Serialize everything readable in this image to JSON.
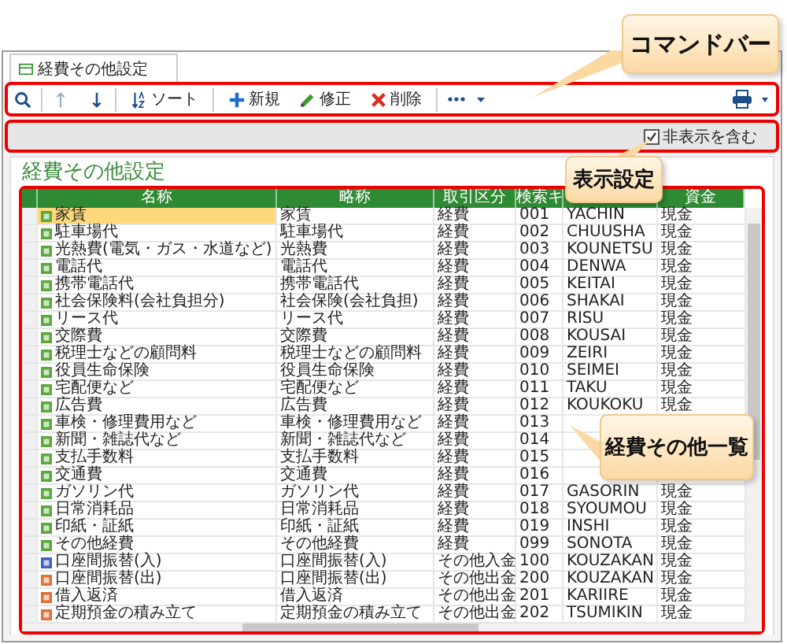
{
  "tab": {
    "label": "経費その他設定",
    "selected": true
  },
  "toolbar": {
    "sort": "ソート",
    "new": "新規",
    "edit": "修正",
    "delete": "削除"
  },
  "display_bar": {
    "checkbox": {
      "label": "非表示を含む",
      "checked": true
    }
  },
  "page_title": "経費その他設定",
  "table": {
    "columns": [
      {
        "label": "名称"
      },
      {
        "label": "略称"
      },
      {
        "label": "取引区分"
      },
      {
        "label": "検索キ"
      },
      {},
      {
        "label": "資金"
      }
    ],
    "rows": [
      {
        "kind": "expense",
        "selected": true,
        "name": "家賃",
        "abbr": "家賃",
        "type": "経費",
        "key": "001",
        "code": "YACHIN",
        "fund": "現金"
      },
      {
        "kind": "expense",
        "selected": false,
        "name": "駐車場代",
        "abbr": "駐車場代",
        "type": "経費",
        "key": "002",
        "code": "CHUUSHA",
        "fund": "現金"
      },
      {
        "kind": "expense",
        "selected": false,
        "name": "光熱費(電気・ガス・水道など)",
        "abbr": "光熱費",
        "type": "経費",
        "key": "003",
        "code": "KOUNETSU",
        "fund": "現金"
      },
      {
        "kind": "expense",
        "selected": false,
        "name": "電話代",
        "abbr": "電話代",
        "type": "経費",
        "key": "004",
        "code": "DENWA",
        "fund": "現金"
      },
      {
        "kind": "expense",
        "selected": false,
        "name": "携帯電話代",
        "abbr": "携帯電話代",
        "type": "経費",
        "key": "005",
        "code": "KEITAI",
        "fund": "現金"
      },
      {
        "kind": "expense",
        "selected": false,
        "name": "社会保険料(会社負担分)",
        "abbr": "社会保険(会社負担)",
        "type": "経費",
        "key": "006",
        "code": "SHAKAI",
        "fund": "現金"
      },
      {
        "kind": "expense",
        "selected": false,
        "name": "リース代",
        "abbr": "リース代",
        "type": "経費",
        "key": "007",
        "code": "RISU",
        "fund": "現金"
      },
      {
        "kind": "expense",
        "selected": false,
        "name": "交際費",
        "abbr": "交際費",
        "type": "経費",
        "key": "008",
        "code": "KOUSAI",
        "fund": "現金"
      },
      {
        "kind": "expense",
        "selected": false,
        "name": "税理士などの顧問料",
        "abbr": "税理士などの顧問料",
        "type": "経費",
        "key": "009",
        "code": "ZEIRI",
        "fund": "現金"
      },
      {
        "kind": "expense",
        "selected": false,
        "name": "役員生命保険",
        "abbr": "役員生命保険",
        "type": "経費",
        "key": "010",
        "code": "SEIMEI",
        "fund": "現金"
      },
      {
        "kind": "expense",
        "selected": false,
        "name": "宅配便など",
        "abbr": "宅配便など",
        "type": "経費",
        "key": "011",
        "code": "TAKU",
        "fund": "現金"
      },
      {
        "kind": "expense",
        "selected": false,
        "name": "広告費",
        "abbr": "広告費",
        "type": "経費",
        "key": "012",
        "code": "KOUKOKU",
        "fund": "現金"
      },
      {
        "kind": "expense",
        "selected": false,
        "name": "車検・修理費用など",
        "abbr": "車検・修理費用など",
        "type": "経費",
        "key": "013"
      },
      {
        "kind": "expense",
        "selected": false,
        "name": "新聞・雑誌代など",
        "abbr": "新聞・雑誌代など",
        "type": "経費",
        "key": "014"
      },
      {
        "kind": "expense",
        "selected": false,
        "name": "支払手数料",
        "abbr": "支払手数料",
        "type": "経費",
        "key": "015"
      },
      {
        "kind": "expense",
        "selected": false,
        "name": "交通費",
        "abbr": "交通費",
        "type": "経費",
        "key": "016"
      },
      {
        "kind": "expense",
        "selected": false,
        "name": "ガソリン代",
        "abbr": "ガソリン代",
        "type": "経費",
        "key": "017",
        "code": "GASORIN",
        "fund": "現金"
      },
      {
        "kind": "expense",
        "selected": false,
        "name": "日常消耗品",
        "abbr": "日常消耗品",
        "type": "経費",
        "key": "018",
        "code": "SYOUMOU",
        "fund": "現金"
      },
      {
        "kind": "expense",
        "selected": false,
        "name": "印紙・証紙",
        "abbr": "印紙・証紙",
        "type": "経費",
        "key": "019",
        "code": "INSHI",
        "fund": "現金"
      },
      {
        "kind": "expense",
        "selected": false,
        "name": "その他経費",
        "abbr": "その他経費",
        "type": "経費",
        "key": "099",
        "code": "SONOTA",
        "fund": "現金"
      },
      {
        "kind": "income",
        "selected": false,
        "name": "口座間振替(入)",
        "abbr": "口座間振替(入)",
        "type": "その他入金",
        "key": "100",
        "code": "KOUZAKAN",
        "fund": "現金"
      },
      {
        "kind": "outgo",
        "selected": false,
        "name": "口座間振替(出)",
        "abbr": "口座間振替(出)",
        "type": "その他出金",
        "key": "200",
        "code": "KOUZAKAN",
        "fund": "現金"
      },
      {
        "kind": "outgo",
        "selected": false,
        "name": "借入返済",
        "abbr": "借入返済",
        "type": "その他出金",
        "key": "201",
        "code": "KARIIRE",
        "fund": "現金"
      },
      {
        "kind": "outgo",
        "selected": false,
        "name": "定期預金の積み立て",
        "abbr": "定期預金の積み立て",
        "type": "その他出金",
        "key": "202",
        "code": "TSUMIKIN",
        "fund": "現金"
      }
    ]
  },
  "callouts": [
    {
      "text": "コマンドバー"
    },
    {
      "text": "表示設定"
    },
    {
      "text": "経費その他一覧"
    }
  ]
}
